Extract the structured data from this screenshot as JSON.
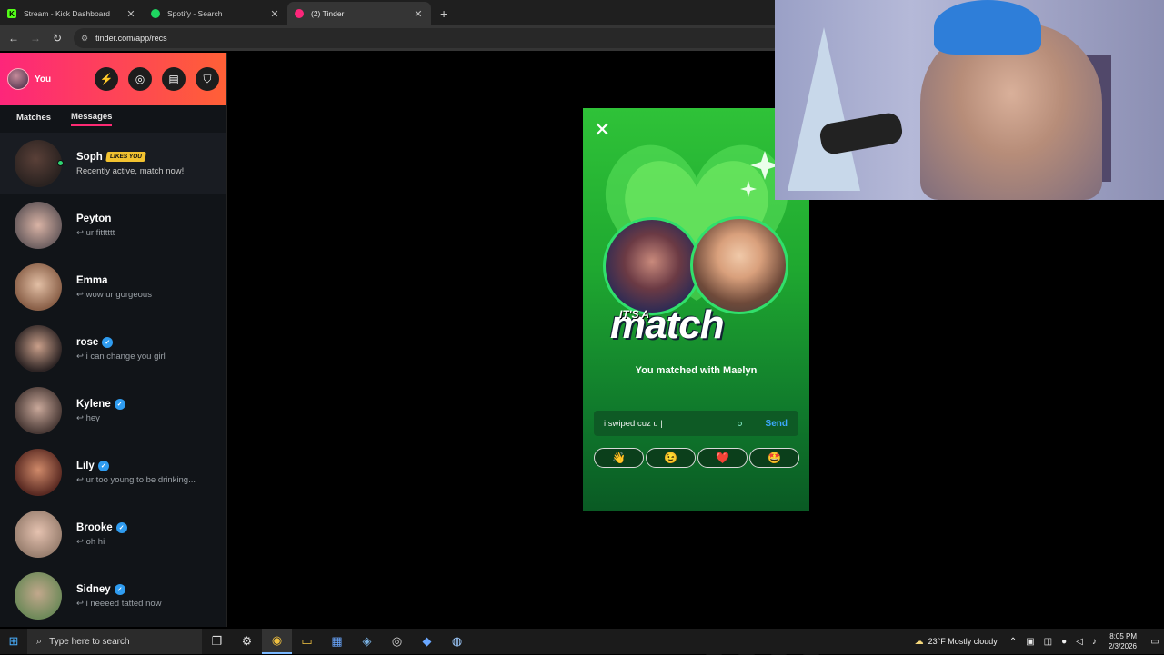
{
  "browser": {
    "tabs": [
      {
        "title": "Stream - Kick Dashboard",
        "favicon": "kick-icon",
        "color": "#53fc18"
      },
      {
        "title": "Spotify - Search",
        "favicon": "spotify-icon",
        "color": "#1ed760"
      },
      {
        "title": "(2) Tinder",
        "favicon": "tinder-icon",
        "color": "#fd267a"
      }
    ],
    "url": "tinder.com/app/recs"
  },
  "sidebar": {
    "user_label": "You",
    "tabs": [
      "Matches",
      "Messages"
    ],
    "likes_badge": "LIKES YOU",
    "conversations": [
      {
        "name": "Soph",
        "message": "Recently active, match now!",
        "likes_you": true,
        "online": true
      },
      {
        "name": "Peyton",
        "message": "↩ ur fitttttt",
        "verified": false
      },
      {
        "name": "Emma",
        "message": "↩ wow ur gorgeous",
        "verified": false
      },
      {
        "name": "rose",
        "message": "↩ i can change you girl",
        "verified": true
      },
      {
        "name": "Kylene",
        "message": "↩ hey",
        "verified": true
      },
      {
        "name": "Lily",
        "message": "↩ ur too young to be drinking...",
        "verified": true
      },
      {
        "name": "Brooke",
        "message": "↩ oh hi",
        "verified": true
      },
      {
        "name": "Sidney",
        "message": "↩ i neeeed tatted now",
        "verified": true
      }
    ]
  },
  "match_modal": {
    "its_a": "IT'S A",
    "headline": "match",
    "matched_text": "You matched with Maelyn",
    "message_value": "i swiped cuz u |",
    "send_label": "Send",
    "quick_replies": [
      "👋",
      "😉",
      "❤️",
      "🤩"
    ]
  },
  "taskbar": {
    "search_placeholder": "Type here to search",
    "weather": "23°F  Mostly cloudy",
    "time": "8:05 PM",
    "date": "2/3/2026"
  },
  "colors": {
    "tinder_gradient_start": "#fd267a",
    "tinder_gradient_end": "#ff6036",
    "match_green": "#1fa830",
    "send_blue": "#3ea9ff"
  }
}
